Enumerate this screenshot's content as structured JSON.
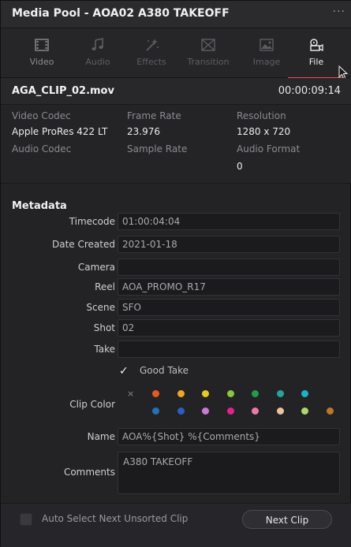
{
  "window": {
    "title": "Media Pool - AOA02 A380 TAKEOFF",
    "more_glyph": "···"
  },
  "tabs": [
    {
      "label": "Video",
      "icon": "film-icon",
      "state": "normal"
    },
    {
      "label": "Audio",
      "icon": "music-note-icon",
      "state": "disabled"
    },
    {
      "label": "Effects",
      "icon": "magic-wand-icon",
      "state": "disabled"
    },
    {
      "label": "Transition",
      "icon": "transition-icon",
      "state": "disabled"
    },
    {
      "label": "Image",
      "icon": "image-icon",
      "state": "disabled"
    },
    {
      "label": "File",
      "icon": "file-reel-icon",
      "state": "active"
    }
  ],
  "file": {
    "name": "AGA_CLIP_02.mov",
    "duration": "00:00:09:14"
  },
  "info": {
    "video_codec_label": "Video Codec",
    "video_codec": "Apple ProRes 422 LT",
    "frame_rate_label": "Frame Rate",
    "frame_rate": "23.976",
    "resolution_label": "Resolution",
    "resolution": "1280 x 720",
    "audio_codec_label": "Audio Codec",
    "sample_rate_label": "Sample Rate",
    "audio_format_label": "Audio Format",
    "audio_format": "0"
  },
  "metadata": {
    "heading": "Metadata",
    "fields": [
      {
        "label": "Timecode",
        "value": "01:00:04:04"
      },
      {
        "label": "Date Created",
        "value": "2021-01-18"
      },
      {
        "label": "Camera",
        "value": ""
      },
      {
        "label": "Reel",
        "value": "AOA_PROMO_R17"
      },
      {
        "label": "Scene",
        "value": "SFO"
      },
      {
        "label": "Shot",
        "value": "02"
      },
      {
        "label": "Take",
        "value": ""
      }
    ],
    "good_take": {
      "label": "Good Take",
      "checked": true,
      "check_glyph": "✓"
    },
    "clip_color": {
      "label": "Clip Color",
      "none_glyph": "×",
      "colors": [
        "#e8581f",
        "#f0a52a",
        "#e9c91f",
        "#8cc63f",
        "#1f9e4a",
        "#25a59a",
        "#1fb0c8",
        "#2272b8",
        "#2a5fbe",
        "#c87ad6",
        "#e2238c",
        "#ea7aa8",
        "#e8c49a",
        "#a9d86b",
        "#b8792a"
      ]
    },
    "name": {
      "label": "Name",
      "value": "AOA%{Shot} %{Comments}"
    },
    "comments": {
      "label": "Comments",
      "value": "A380 TAKEOFF"
    }
  },
  "footer": {
    "auto_select_label": "Auto Select Next Unsorted Clip",
    "auto_select_checked": false,
    "next_clip_label": "Next Clip"
  },
  "colors": {
    "accent_underline": "#e0524d",
    "panel_bg": "#232326"
  }
}
